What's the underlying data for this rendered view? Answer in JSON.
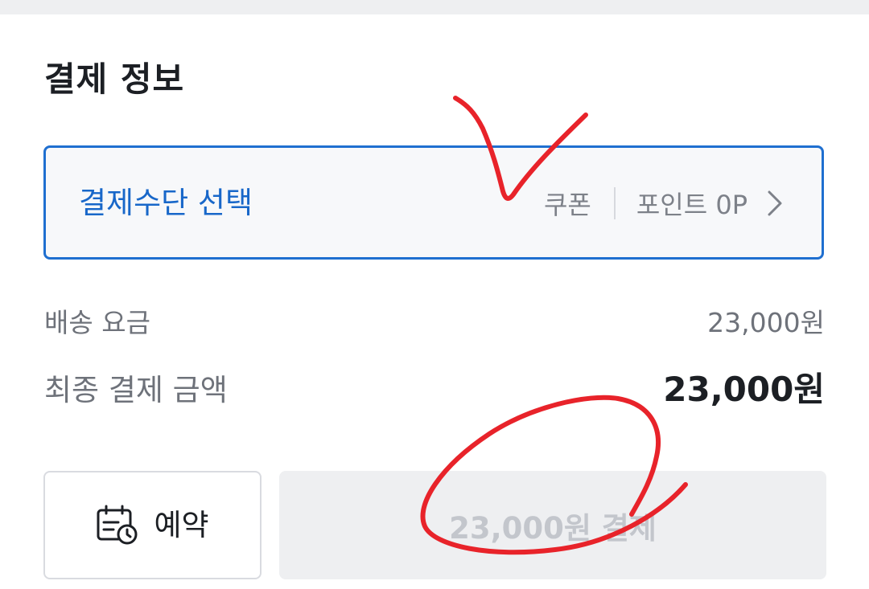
{
  "payment_info": {
    "title": "결제 정보",
    "method": {
      "label": "결제수단 선택",
      "coupon_label": "쿠폰",
      "points_label": "포인트 0P"
    },
    "shipping_fee": {
      "label": "배송 요금",
      "value": "23,000원"
    },
    "final_amount": {
      "label": "최종 결제 금액",
      "value": "23,000원"
    }
  },
  "actions": {
    "reserve_label": "예약",
    "pay_label": "23,000원 결제",
    "pay_enabled": false
  },
  "icons": {
    "method_chevron": "chevron-right-icon",
    "reserve": "calendar-clock-icon"
  },
  "colors": {
    "accent": "#1f6fd0",
    "annotation": "#e8232a",
    "disabled_button_bg": "#eeeff1",
    "disabled_button_text": "#c3c6cc"
  }
}
